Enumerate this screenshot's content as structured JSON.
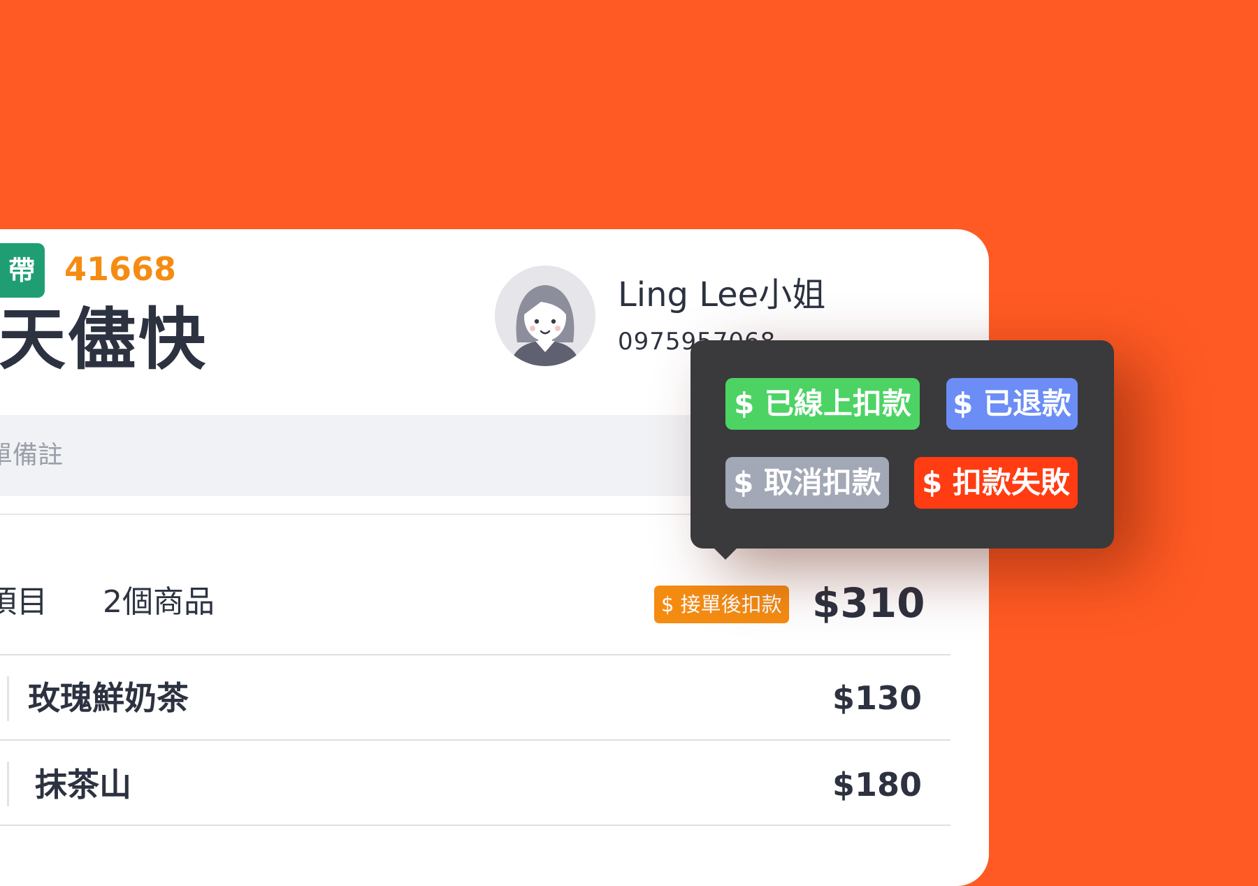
{
  "order": {
    "tag_label": "帶",
    "number": "41668",
    "title": "今天儘快",
    "customer": {
      "name": "Ling Lee小姐",
      "phone": "0975957068"
    },
    "note_placeholder": "單備註",
    "items_header": {
      "label": "項目",
      "count": "2個商品",
      "payment_status": "$ 接單後扣款",
      "total": "$310"
    },
    "items": [
      {
        "name": "玫瑰鮮奶茶",
        "price": "$130"
      },
      {
        "name": "抹茶山",
        "price": "$180"
      }
    ]
  },
  "payment_popup": {
    "options": [
      {
        "label": "$ 已線上扣款",
        "color": "#4cd364"
      },
      {
        "label": "$ 已退款",
        "color": "#6b8df5"
      },
      {
        "label": "$ 取消扣款",
        "color": "#a3a8b6"
      },
      {
        "label": "$ 扣款失敗",
        "color": "#ff3c12"
      }
    ]
  },
  "colors": {
    "background": "#ff5a23",
    "tag": "#1f9e74",
    "order_number": "#f58c12",
    "popup": "#3a3a3c"
  }
}
